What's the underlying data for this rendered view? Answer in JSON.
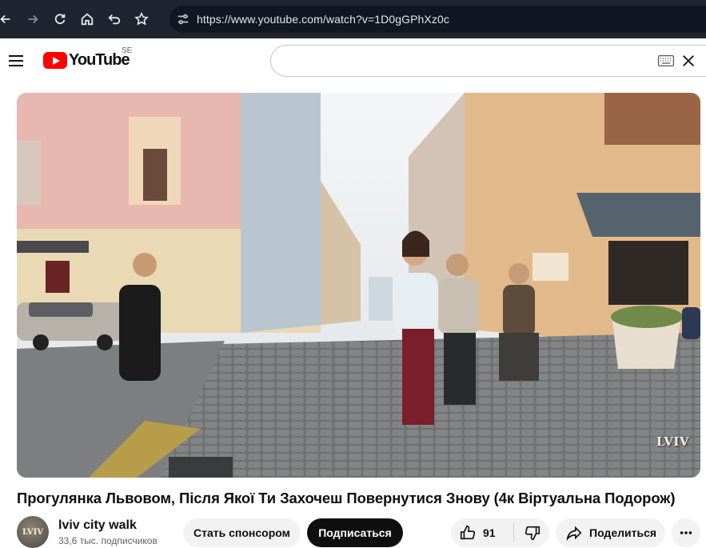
{
  "browser": {
    "url": "https://www.youtube.com/watch?v=1D0gGPhXz0c",
    "back_icon": "arrow-left",
    "forward_icon": "arrow-right",
    "reload_icon": "reload",
    "home_icon": "home",
    "undo_icon": "undo",
    "bookmark_icon": "star"
  },
  "header": {
    "logo_text": "YouTube",
    "region": "SE",
    "search_value": "",
    "keyboard_icon": "keyboard",
    "clear_icon": "close-x"
  },
  "video": {
    "watermark": "LVIV"
  },
  "title": "Прогулянка Львовом, Після Якої Ти Захочеш Повернутися Знову (4к Віртуальна Подорож)",
  "owner": {
    "avatar_text": "LVIV",
    "channel_name": "lviv city walk",
    "subscribers": "33,6 тыс. подписчиков"
  },
  "actions": {
    "sponsor_label": "Стать спонсором",
    "subscribe_label": "Подписаться",
    "like_count": "91",
    "share_label": "Поделиться",
    "more_icon": "three-dots"
  },
  "colors": {
    "chrome_bg": "#1f2430",
    "youtube_red": "#ff0000",
    "subscribe_bg": "#0f0f0f",
    "pill_bg": "#f2f2f2"
  }
}
